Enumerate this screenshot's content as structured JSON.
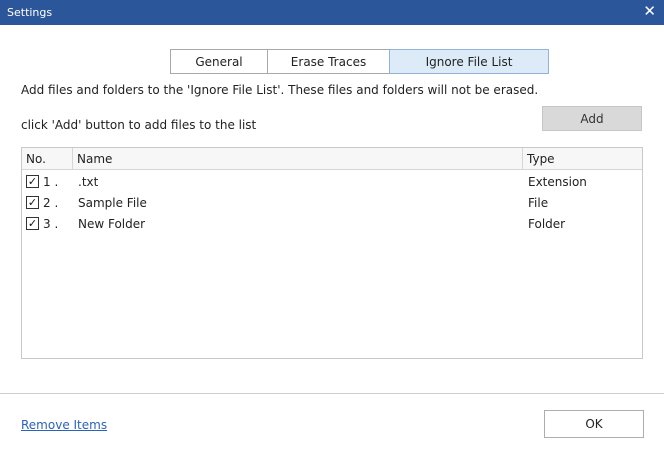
{
  "window": {
    "title": "Settings",
    "close_glyph": "✕"
  },
  "tabs": [
    {
      "label": "General",
      "active": false
    },
    {
      "label": "Erase Traces",
      "active": false
    },
    {
      "label": "Ignore File List",
      "active": true
    }
  ],
  "description": "Add files and folders to the 'Ignore File List'. These files and folders will not be erased.",
  "hint": "click 'Add' button to add files to the list",
  "add_button": "Add",
  "list": {
    "columns": {
      "no": "No.",
      "name": "Name",
      "type": "Type"
    },
    "rows": [
      {
        "checked": true,
        "no": "1 .",
        "name": ".txt",
        "type": "Extension"
      },
      {
        "checked": true,
        "no": "2 .",
        "name": "Sample File",
        "type": "File"
      },
      {
        "checked": true,
        "no": "3 .",
        "name": "New Folder",
        "type": "Folder"
      }
    ]
  },
  "remove_link": "Remove Items",
  "ok_button": "OK",
  "colors": {
    "titlebar": "#2b579a",
    "active_tab": "#ddebf8",
    "link": "#2b63b8"
  }
}
